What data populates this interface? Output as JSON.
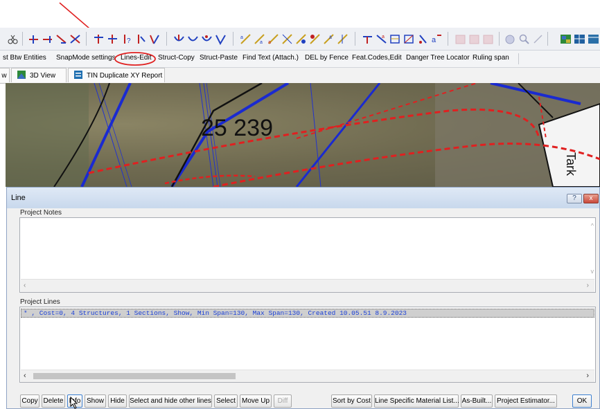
{
  "command_toolbar": {
    "items": [
      "st Btw Entities",
      "SnapMode settings",
      "Lines-Edit",
      "Struct-Copy",
      "Struct-Paste",
      "Find Text (Attach.)",
      "DEL by Fence",
      "Feat.Codes,Edit",
      "Danger Tree Locator",
      "Ruling span"
    ],
    "highlighted": "Lines-Edit"
  },
  "tabs": {
    "t0": "w",
    "t1": "3D View",
    "t2": "TIN Duplicate XY Report"
  },
  "map": {
    "label_main": "25 239",
    "label_side": "Tark"
  },
  "dialog": {
    "title": "Line",
    "help_btn": "?",
    "close_btn": "x",
    "project_notes_label": "Project Notes",
    "project_lines_label": "Project Lines",
    "selected_line": "* , Cost=0, 4 Structures, 1 Sections, Show, Min Span=130, Max Span=130, Created 10.05.51 8.9.2023",
    "buttons": {
      "copy": "Copy",
      "delete": "Delete",
      "info": "Info",
      "show": "Show",
      "hide": "Hide",
      "select_hide_other": "Select and hide other lines",
      "select": "Select",
      "move_up": "Move Up",
      "diff": "Diff",
      "sort_by_cost": "Sort by Cost",
      "material_list": "Line Specific Material List...",
      "as_built": "As-Built...",
      "project_estimator": "Project Estimator...",
      "ok": "OK"
    }
  },
  "colors": {
    "annotation_red": "#e02020",
    "selection_row": "#cfcfcf",
    "selection_text": "#1a3fd6"
  }
}
